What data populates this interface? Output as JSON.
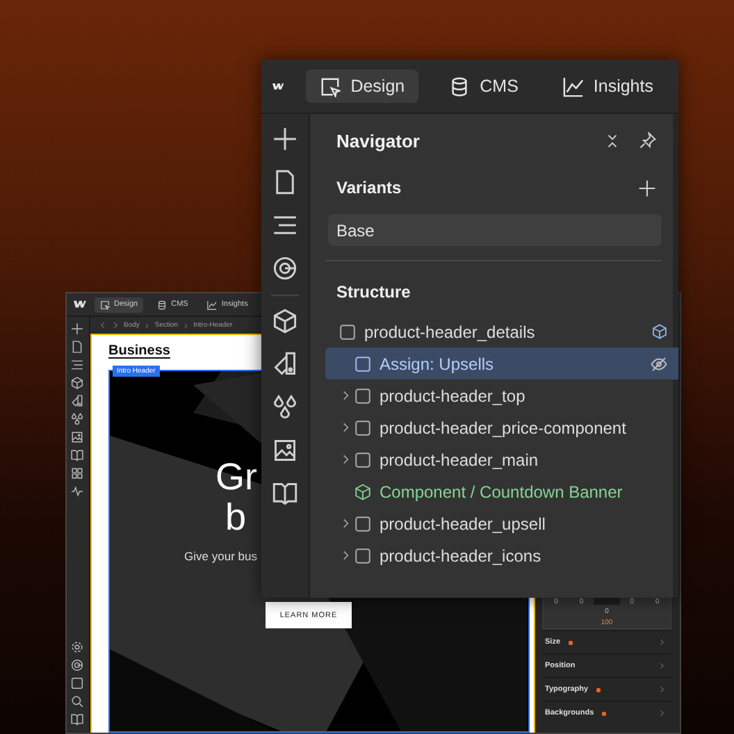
{
  "back_window": {
    "tabs": [
      {
        "label": "Design",
        "selected": true
      },
      {
        "label": "CMS",
        "selected": false
      },
      {
        "label": "Insights",
        "selected": false
      }
    ],
    "breadcrumb": [
      "Body",
      "Section",
      "Intro-Header"
    ],
    "page": {
      "brand": "Business",
      "badge": "Intro Header",
      "heading_lines": [
        "Gr",
        "b"
      ],
      "subtitle": "Give your bus",
      "button": "LEARN MORE"
    },
    "style_panel": {
      "spacing_values": [
        "0",
        "0",
        "0",
        "0"
      ],
      "center_value": "0",
      "bottom_value": "100",
      "sections": [
        {
          "label": "Size",
          "modified": true
        },
        {
          "label": "Position",
          "modified": false
        },
        {
          "label": "Typography",
          "modified": true
        },
        {
          "label": "Backgrounds",
          "modified": true
        }
      ]
    }
  },
  "navigator_window": {
    "tabs": [
      {
        "label": "Design",
        "selected": true
      },
      {
        "label": "CMS",
        "selected": false
      },
      {
        "label": "Insights",
        "selected": false
      }
    ],
    "title": "Navigator",
    "variants_heading": "Variants",
    "variants": [
      "Base"
    ],
    "structure_heading": "Structure",
    "tree": [
      {
        "label": "product-header_details",
        "kind": "element",
        "selected": false,
        "component_badge": true,
        "hidden": false,
        "children": [
          {
            "label": "Assign: Upsells",
            "kind": "element",
            "selected": true,
            "component_badge": false,
            "hidden": true
          },
          {
            "label": "product-header_top",
            "kind": "element",
            "selected": false,
            "collapsed": true,
            "component_badge": false,
            "hidden": false
          },
          {
            "label": "product-header_price-component",
            "kind": "element",
            "selected": false,
            "collapsed": true,
            "component_badge": false,
            "hidden": false
          },
          {
            "label": "product-header_main",
            "kind": "element",
            "selected": false,
            "collapsed": true,
            "component_badge": false,
            "hidden": false
          },
          {
            "label": "Component / Countdown Banner",
            "kind": "component",
            "selected": false,
            "component_badge": false,
            "hidden": false
          },
          {
            "label": "product-header_upsell",
            "kind": "element",
            "selected": false,
            "collapsed": true,
            "component_badge": false,
            "hidden": false
          },
          {
            "label": "product-header_icons",
            "kind": "element",
            "selected": false,
            "collapsed": true,
            "component_badge": false,
            "hidden": false
          }
        ]
      }
    ]
  }
}
